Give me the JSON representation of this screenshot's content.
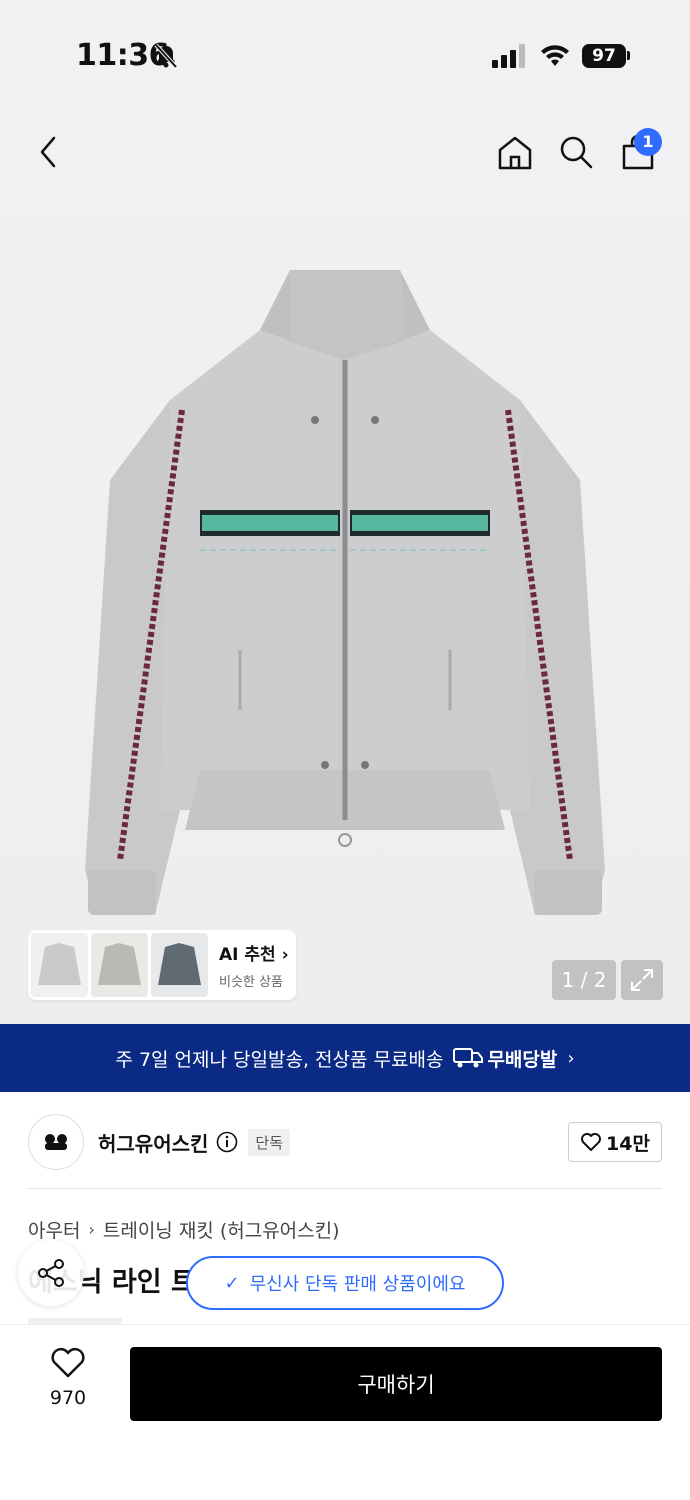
{
  "status_bar": {
    "time": "11:36",
    "battery": "97"
  },
  "nav": {
    "cart_count": "1"
  },
  "gallery": {
    "counter": "1 / 2",
    "ai_title": "AI 추천",
    "ai_subtitle": "비슷한 상품"
  },
  "promo": {
    "text": "주 7일 언제나 당일발송, 전상품 무료배송",
    "badge": "무배당발"
  },
  "brand": {
    "name": "허그유어스킨",
    "tag": "단독",
    "likes": "14만"
  },
  "breadcrumb": {
    "category": "아우터",
    "subcategory": "트레이닝 재킷 (허그유어스킨)"
  },
  "product": {
    "title_partial": "에스닉 라인 트"
  },
  "toast": {
    "text": "무신사 단독 판매 상품이에요"
  },
  "bottom": {
    "wish_count": "970",
    "buy_label": "구매하기"
  },
  "colors": {
    "accent": "#2f6bff",
    "banner": "#0b2a86",
    "buy": "#000000"
  }
}
